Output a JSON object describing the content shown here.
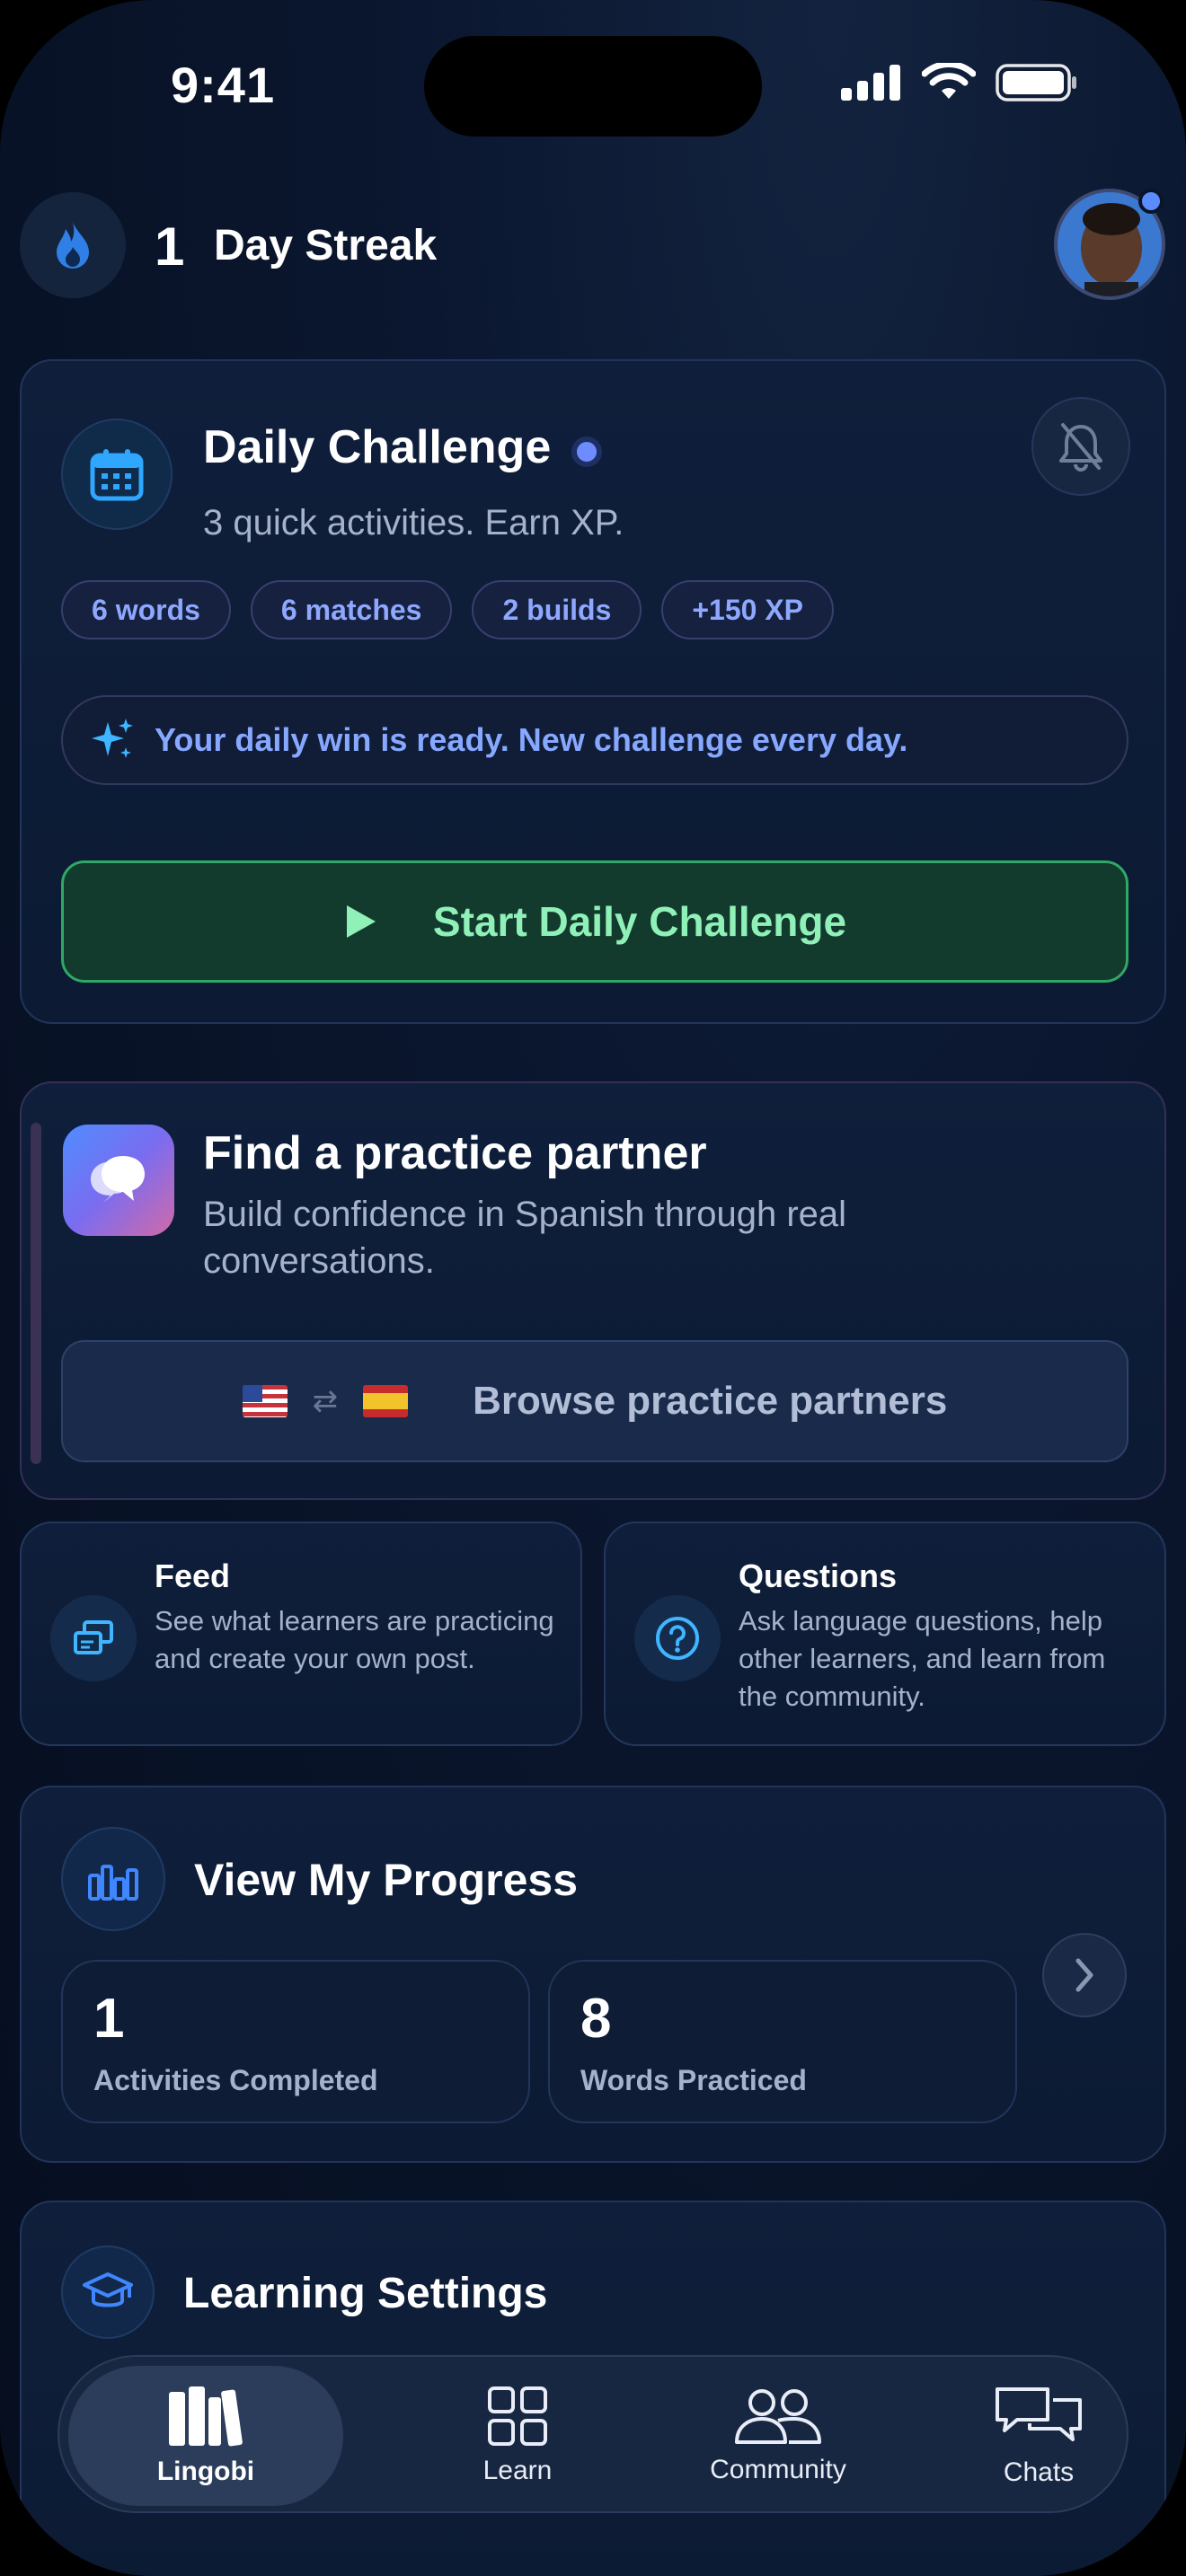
{
  "status_bar": {
    "time": "9:41"
  },
  "header": {
    "streak_count": "1",
    "streak_label": "Day Streak"
  },
  "daily_challenge": {
    "title": "Daily Challenge",
    "subtitle": "3 quick activities. Earn XP.",
    "chips": [
      "6 words",
      "6 matches",
      "2 builds",
      "+150 XP"
    ],
    "tip": "Your daily win is ready. New challenge every day.",
    "start_label": "Start Daily Challenge"
  },
  "partner": {
    "title": "Find a practice partner",
    "subtitle": "Build confidence in Spanish through real conversations.",
    "swap_symbol": "⇄",
    "browse_label": "Browse practice partners"
  },
  "feed": {
    "title": "Feed",
    "description": "See what learners are practicing and create your own post."
  },
  "questions": {
    "title": "Questions",
    "description": "Ask language questions, help other learners, and learn from the community."
  },
  "progress": {
    "title": "View My Progress",
    "stats": [
      {
        "value": "1",
        "label": "Activities Completed"
      },
      {
        "value": "8",
        "label": "Words Practiced"
      }
    ]
  },
  "learning_settings": {
    "title": "Learning Settings"
  },
  "tabs": [
    {
      "label": "Lingobi",
      "icon": "books-icon",
      "active": true
    },
    {
      "label": "Learn",
      "icon": "grid-icon",
      "active": false
    },
    {
      "label": "Community",
      "icon": "people-icon",
      "active": false
    },
    {
      "label": "Chats",
      "icon": "chat-bubbles-icon",
      "active": false
    }
  ],
  "colors": {
    "accent_blue": "#8ea8ff",
    "success_green": "#2fa866",
    "background": "#0b1730"
  }
}
